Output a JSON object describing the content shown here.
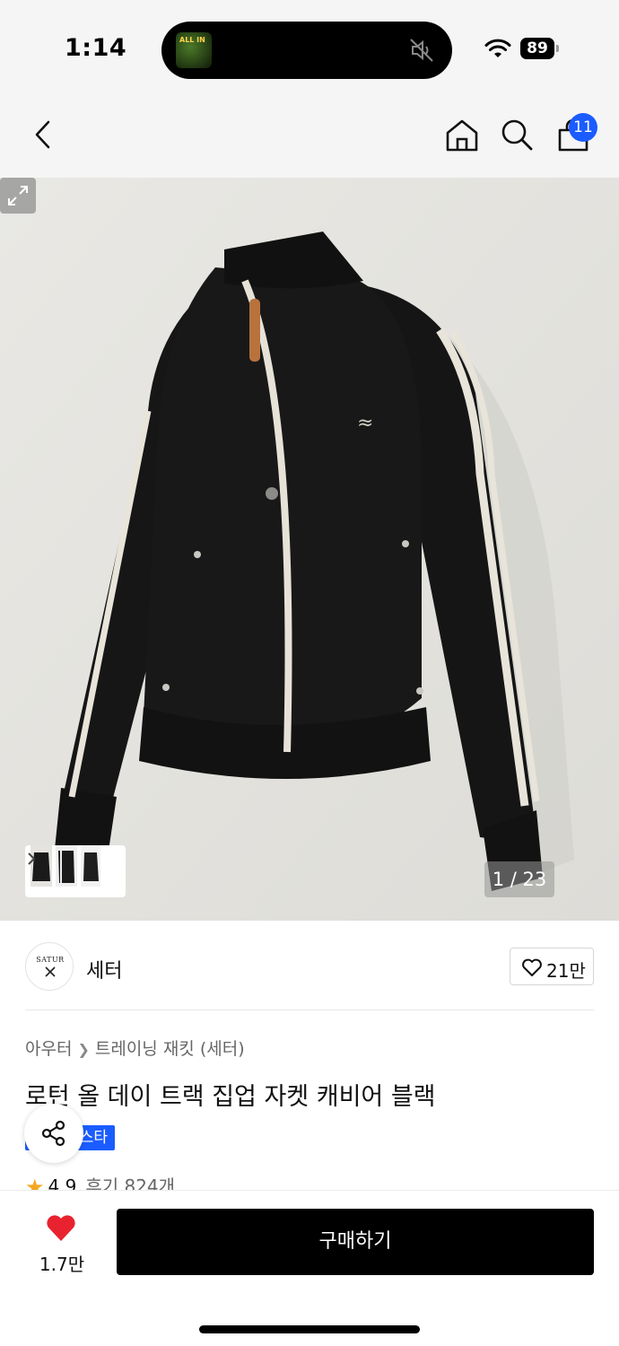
{
  "status_bar": {
    "time": "1:14",
    "island_art_text": "ALL IN",
    "battery": "89"
  },
  "nav": {
    "cart_count": "11"
  },
  "gallery": {
    "counter": "1 / 23"
  },
  "brand": {
    "logo_text": "SATUR",
    "name": "세터",
    "like_count": "21만"
  },
  "product": {
    "breadcrumb": [
      "아우터",
      "트레이닝 재킷 (세터)"
    ],
    "title": "로턴 올 데이 트랙 집업 자켓 캐비어 블랙",
    "tag": "스타",
    "rating": "4.9",
    "reviews": "후기 824개"
  },
  "bottom": {
    "wish_count": "1.7만",
    "buy_label": "구매하기"
  },
  "colors": {
    "accent_blue": "#1a5cff",
    "wish_red": "#e8232f",
    "buy_black": "#000000"
  },
  "icons": [
    "back-icon",
    "home-icon",
    "search-icon",
    "shopping-bag-icon",
    "chevron-right-icon",
    "expand-icon",
    "heart-outline-icon",
    "share-icon",
    "star-icon",
    "heart-filled-icon",
    "wifi-icon",
    "mute-icon"
  ]
}
